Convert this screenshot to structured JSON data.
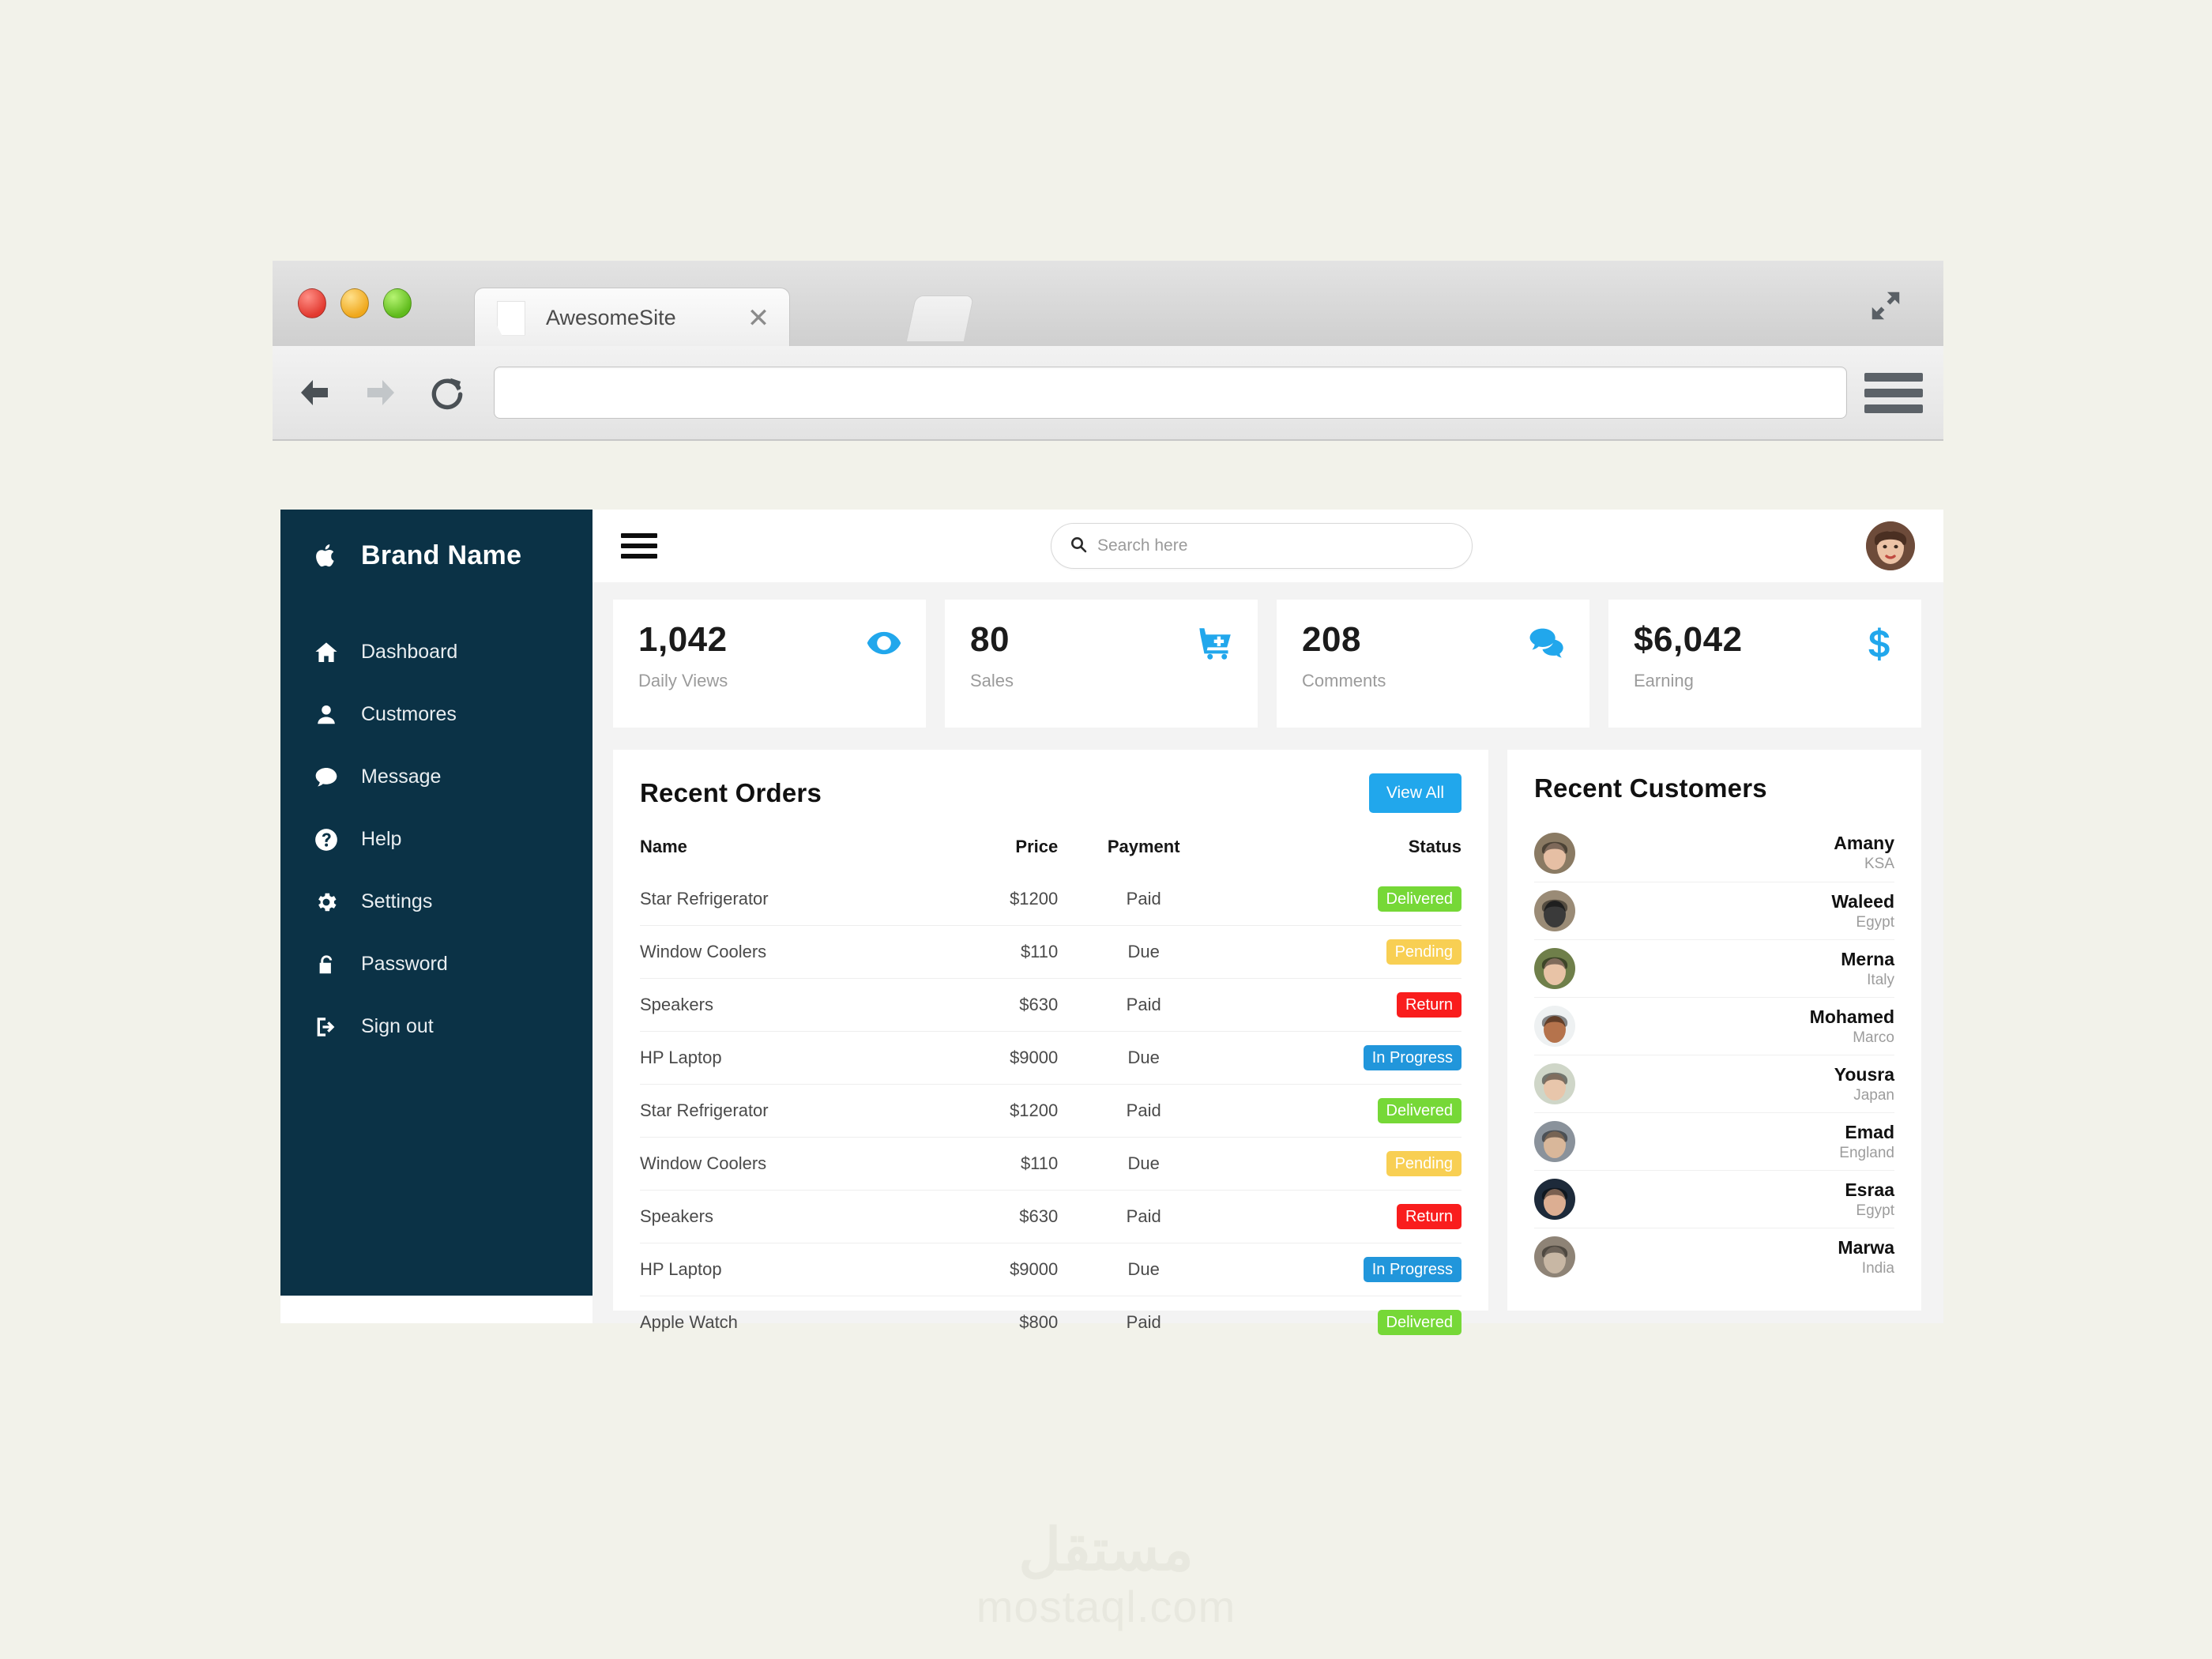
{
  "browser": {
    "tab_title": "AwesomeSite",
    "close_label": "✕",
    "url_value": "",
    "url_placeholder": ""
  },
  "sidebar": {
    "brand_name": "Brand Name",
    "brand_icon": "apple-icon",
    "items": [
      {
        "label": "Dashboard",
        "icon": "home-icon"
      },
      {
        "label": "Custmores",
        "icon": "user-icon"
      },
      {
        "label": "Message",
        "icon": "chat-icon"
      },
      {
        "label": "Help",
        "icon": "question-circle-icon"
      },
      {
        "label": "Settings",
        "icon": "gear-icon"
      },
      {
        "label": "Password",
        "icon": "unlock-icon"
      },
      {
        "label": "Sign out",
        "icon": "sign-out-icon"
      }
    ]
  },
  "topbar": {
    "search_value": "",
    "search_placeholder": "Search here"
  },
  "stats": [
    {
      "value": "1,042",
      "label": "Daily Views",
      "icon": "eye-icon"
    },
    {
      "value": "80",
      "label": "Sales",
      "icon": "cart-plus-icon"
    },
    {
      "value": "208",
      "label": "Comments",
      "icon": "comments-icon"
    },
    {
      "value": "$6,042",
      "label": "Earning",
      "icon": "dollar-icon"
    }
  ],
  "orders": {
    "title": "Recent Orders",
    "view_all_label": "View All",
    "columns": [
      "Name",
      "Price",
      "Payment",
      "Status"
    ],
    "rows": [
      {
        "name": "Star Refrigerator",
        "price": "$1200",
        "payment": "Paid",
        "status": "Delivered",
        "status_color": "#76d837"
      },
      {
        "name": "Window Coolers",
        "price": "$110",
        "payment": "Due",
        "status": "Pending",
        "status_color": "#f8cf53"
      },
      {
        "name": "Speakers",
        "price": "$630",
        "payment": "Paid",
        "status": "Return",
        "status_color": "#f91d1d"
      },
      {
        "name": "HP Laptop",
        "price": "$9000",
        "payment": "Due",
        "status": "In Progress",
        "status_color": "#2196db"
      },
      {
        "name": "Star Refrigerator",
        "price": "$1200",
        "payment": "Paid",
        "status": "Delivered",
        "status_color": "#76d837"
      },
      {
        "name": "Window Coolers",
        "price": "$110",
        "payment": "Due",
        "status": "Pending",
        "status_color": "#f8cf53"
      },
      {
        "name": "Speakers",
        "price": "$630",
        "payment": "Paid",
        "status": "Return",
        "status_color": "#f91d1d"
      },
      {
        "name": "HP Laptop",
        "price": "$9000",
        "payment": "Due",
        "status": "In Progress",
        "status_color": "#2196db"
      },
      {
        "name": "Apple Watch",
        "price": "$800",
        "payment": "Paid",
        "status": "Delivered",
        "status_color": "#76d837"
      }
    ]
  },
  "customers": {
    "title": "Recent Customers",
    "rows": [
      {
        "name": "Amany",
        "country": "KSA",
        "avatar_bg": "#8a7a63",
        "avatar_skin": "#e6bfa4"
      },
      {
        "name": "Waleed",
        "country": "Egypt",
        "avatar_bg": "#9a8b76",
        "avatar_skin": "#3a3a3a"
      },
      {
        "name": "Merna",
        "country": "Italy",
        "avatar_bg": "#6f7f4a",
        "avatar_skin": "#e8c3a6"
      },
      {
        "name": "Mohamed",
        "country": "Marco",
        "avatar_bg": "#eef1f2",
        "avatar_skin": "#b5734c"
      },
      {
        "name": "Yousra",
        "country": "Japan",
        "avatar_bg": "#cfd6c8",
        "avatar_skin": "#e8c6ab"
      },
      {
        "name": "Emad",
        "country": "England",
        "avatar_bg": "#8a929b",
        "avatar_skin": "#d9b79a"
      },
      {
        "name": "Esraa",
        "country": "Egypt",
        "avatar_bg": "#1d2a3a",
        "avatar_skin": "#dcae92"
      },
      {
        "name": "Marwa",
        "country": "India",
        "avatar_bg": "#8e8376",
        "avatar_skin": "#c8b7a4"
      }
    ]
  },
  "watermark": {
    "arabic": "مستقل",
    "latin": "mostaql.com"
  },
  "theme": {
    "sidebar_bg": "#0b3246",
    "accent": "#21a7ec",
    "page_bg": "#f2f2ea"
  }
}
